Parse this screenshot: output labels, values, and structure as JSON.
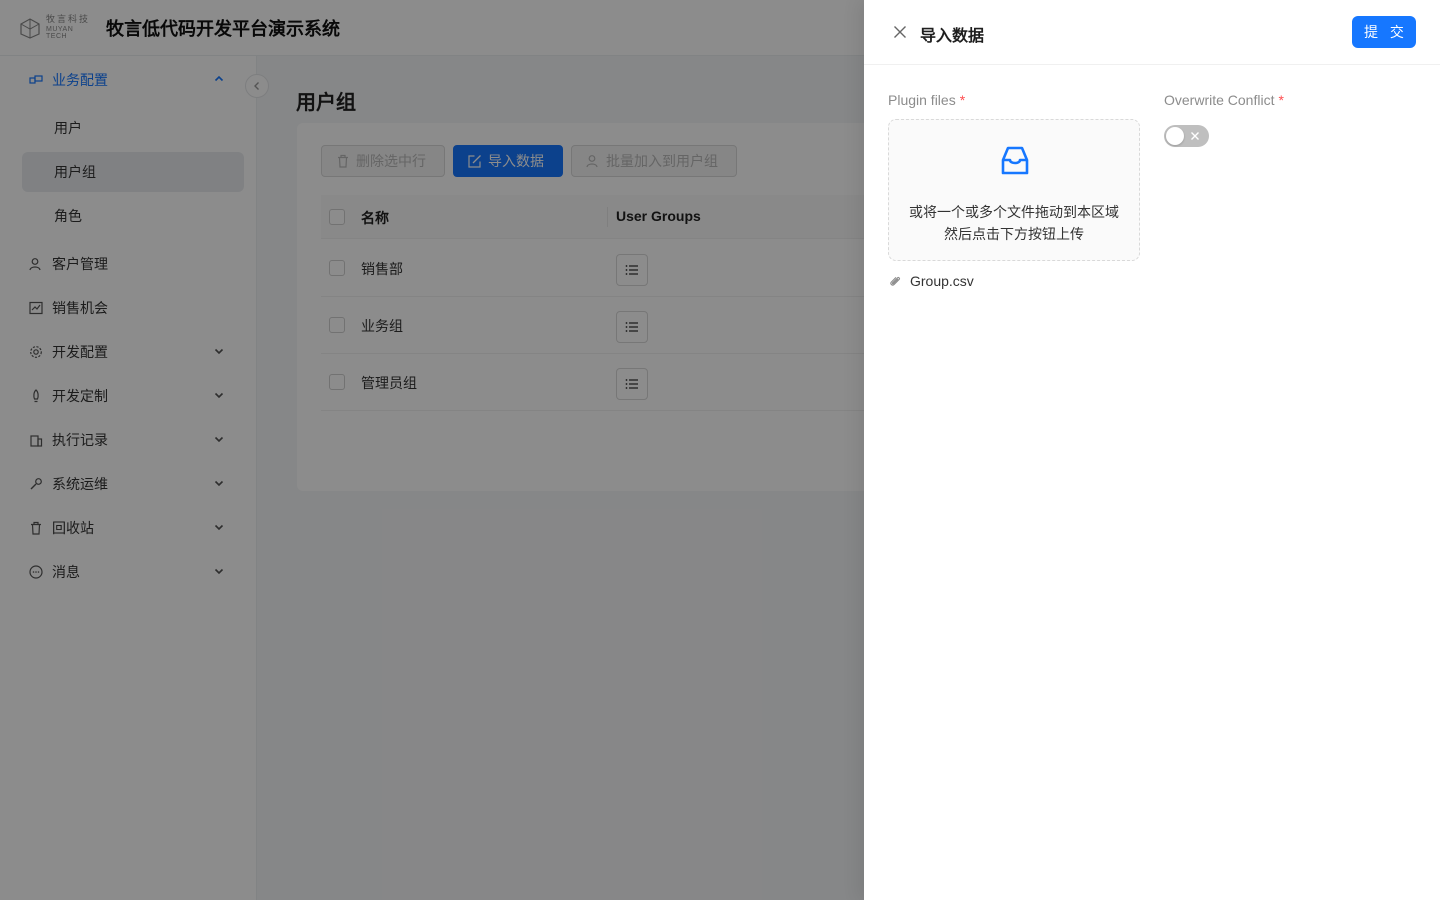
{
  "header": {
    "logo_cn": "牧言科技",
    "logo_en": "MUYAN TECH",
    "title": "牧言低代码开发平台演示系统"
  },
  "sidebar": {
    "groups": [
      {
        "label": "业务配置",
        "icon": "business-config-icon",
        "expanded": true,
        "children": [
          {
            "label": "用户"
          },
          {
            "label": "用户组",
            "selected": true
          },
          {
            "label": "角色"
          }
        ]
      },
      {
        "label": "客户管理",
        "icon": "customer-icon"
      },
      {
        "label": "销售机会",
        "icon": "chart-icon"
      },
      {
        "label": "开发配置",
        "icon": "gear-icon",
        "expandable": true
      },
      {
        "label": "开发定制",
        "icon": "rocket-icon",
        "expandable": true
      },
      {
        "label": "执行记录",
        "icon": "building-icon",
        "expandable": true
      },
      {
        "label": "系统运维",
        "icon": "wrench-icon",
        "expandable": true
      },
      {
        "label": "回收站",
        "icon": "trash-icon",
        "expandable": true
      },
      {
        "label": "消息",
        "icon": "message-icon",
        "expandable": true
      }
    ]
  },
  "page": {
    "title": "用户组",
    "toolbar": {
      "delete_label": "删除选中行",
      "import_label": "导入数据",
      "batch_add_label": "批量加入到用户组"
    },
    "table": {
      "columns": [
        "名称",
        "User Groups"
      ],
      "rows": [
        {
          "name": "销售部"
        },
        {
          "name": "业务组"
        },
        {
          "name": "管理员组"
        }
      ]
    }
  },
  "drawer": {
    "title": "导入数据",
    "submit_label": "提 交",
    "plugin_files_label": "Plugin files",
    "overwrite_label": "Overwrite Conflict",
    "required_mark": "*",
    "dropzone_line1": "或将一个或多个文件拖动到本区域",
    "dropzone_line2": "然后点击下方按钮上传",
    "file_name": "Group.csv",
    "overwrite_enabled": false
  },
  "colors": {
    "accent": "#1677ff",
    "required": "#ff4d4f"
  }
}
